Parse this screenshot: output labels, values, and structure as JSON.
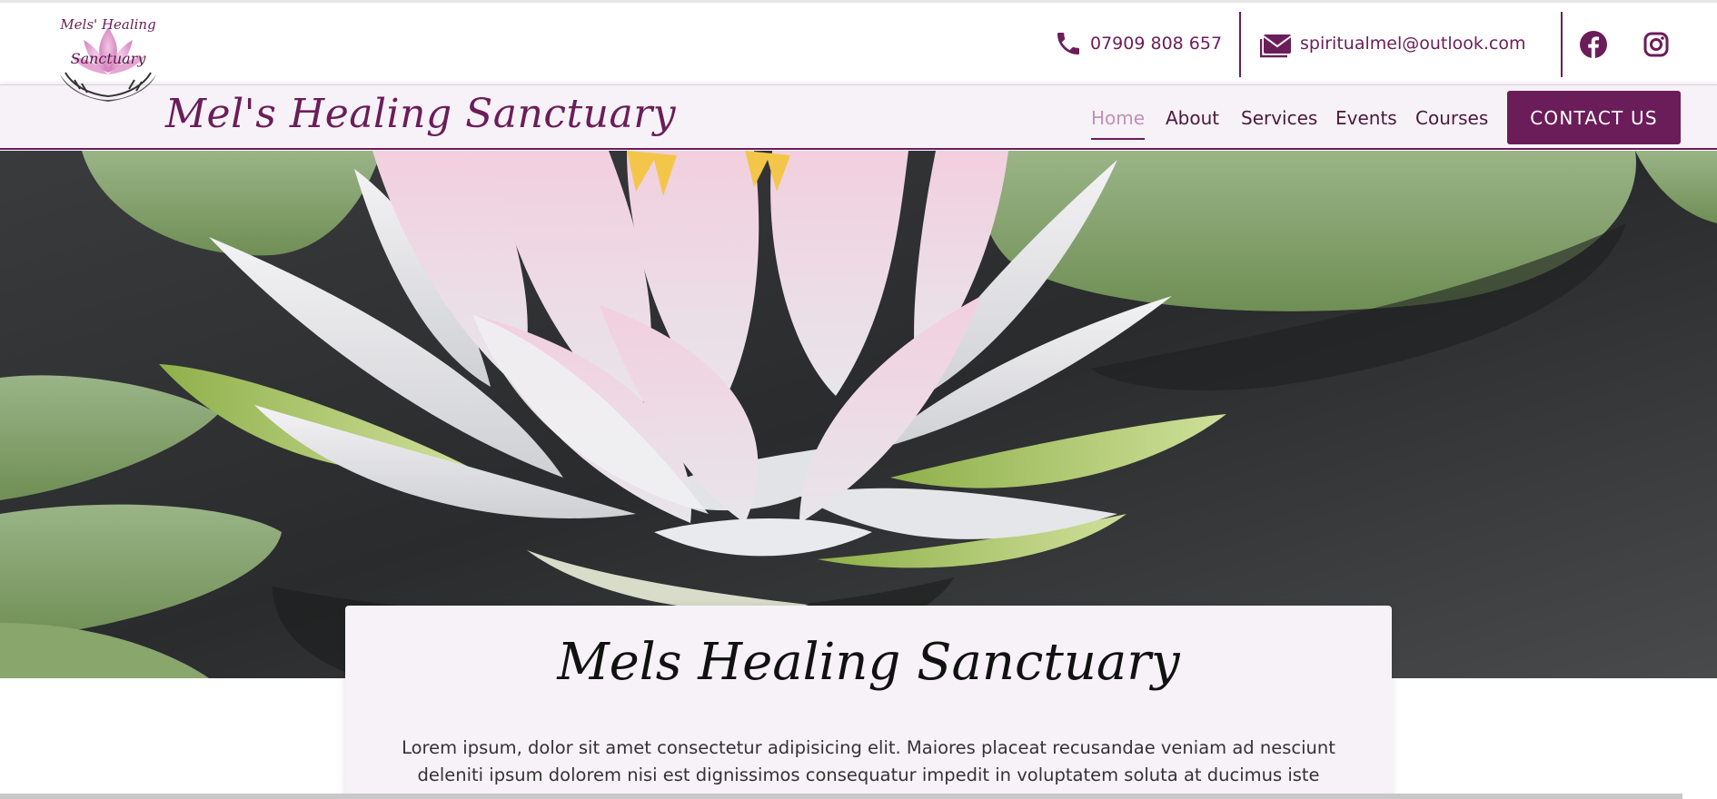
{
  "colors": {
    "brand": "#6b1d59",
    "nav_bg": "#f7f2f8",
    "active_nav": "#c58fb5"
  },
  "topbar": {
    "phone": "07909 808 657",
    "email": "spiritualmel@outlook.com",
    "icons": [
      "phone-icon",
      "envelope-icon",
      "facebook-icon",
      "instagram-icon"
    ]
  },
  "logo": {
    "text_line1": "Mels' Healing",
    "text_line2": "Sanctuary"
  },
  "navbar": {
    "brand": "Mel's Healing Sanctuary",
    "items": [
      {
        "label": "Home",
        "active": true
      },
      {
        "label": "About"
      },
      {
        "label": "Services"
      },
      {
        "label": "Events"
      },
      {
        "label": "Courses"
      }
    ],
    "cta": "CONTACT US"
  },
  "hero_card": {
    "title": "Mels Healing Sanctuary",
    "body": "Lorem ipsum, dolor sit amet consectetur adipisicing elit. Maiores placeat recusandae veniam ad nesciunt deleniti ipsum dolorem nisi est dignissimos consequatur impedit in voluptatem soluta at ducimus iste"
  }
}
